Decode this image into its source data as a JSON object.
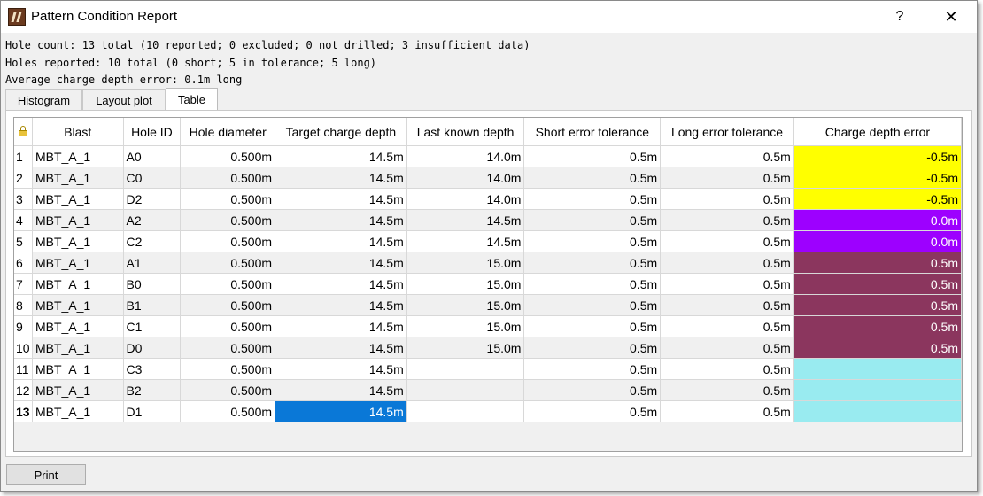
{
  "window": {
    "title": "Pattern Condition Report",
    "help_label": "?",
    "close_label": "✕"
  },
  "summary": {
    "line1": "Hole count: 13 total (10 reported; 0 excluded; 0 not drilled; 3 insufficient data)",
    "line2": "Holes reported: 10 total (0 short; 5 in tolerance; 5 long)",
    "line3": "Average charge depth error: 0.1m long"
  },
  "tabs": [
    {
      "label": "Histogram"
    },
    {
      "label": "Layout plot"
    },
    {
      "label": "Table"
    }
  ],
  "active_tab": "Table",
  "table": {
    "headers": [
      "Blast",
      "Hole ID",
      "Hole diameter",
      "Target charge depth",
      "Last known depth",
      "Short error tolerance",
      "Long error tolerance",
      "Charge depth error"
    ],
    "rows": [
      {
        "n": "1",
        "blast": "MBT_A_1",
        "hole": "A0",
        "diam": "0.500m",
        "target": "14.5m",
        "last": "14.0m",
        "short": "0.5m",
        "long": "0.5m",
        "err": "-0.5m",
        "err_color": "#ffff00",
        "err_text_color": "#000000"
      },
      {
        "n": "2",
        "blast": "MBT_A_1",
        "hole": "C0",
        "diam": "0.500m",
        "target": "14.5m",
        "last": "14.0m",
        "short": "0.5m",
        "long": "0.5m",
        "err": "-0.5m",
        "err_color": "#ffff00",
        "err_text_color": "#000000"
      },
      {
        "n": "3",
        "blast": "MBT_A_1",
        "hole": "D2",
        "diam": "0.500m",
        "target": "14.5m",
        "last": "14.0m",
        "short": "0.5m",
        "long": "0.5m",
        "err": "-0.5m",
        "err_color": "#ffff00",
        "err_text_color": "#000000"
      },
      {
        "n": "4",
        "blast": "MBT_A_1",
        "hole": "A2",
        "diam": "0.500m",
        "target": "14.5m",
        "last": "14.5m",
        "short": "0.5m",
        "long": "0.5m",
        "err": "0.0m",
        "err_color": "#9d00ff",
        "err_text_color": "#ffffff"
      },
      {
        "n": "5",
        "blast": "MBT_A_1",
        "hole": "C2",
        "diam": "0.500m",
        "target": "14.5m",
        "last": "14.5m",
        "short": "0.5m",
        "long": "0.5m",
        "err": "0.0m",
        "err_color": "#9d00ff",
        "err_text_color": "#ffffff"
      },
      {
        "n": "6",
        "blast": "MBT_A_1",
        "hole": "A1",
        "diam": "0.500m",
        "target": "14.5m",
        "last": "15.0m",
        "short": "0.5m",
        "long": "0.5m",
        "err": "0.5m",
        "err_color": "#8b365e",
        "err_text_color": "#ffffff"
      },
      {
        "n": "7",
        "blast": "MBT_A_1",
        "hole": "B0",
        "diam": "0.500m",
        "target": "14.5m",
        "last": "15.0m",
        "short": "0.5m",
        "long": "0.5m",
        "err": "0.5m",
        "err_color": "#8b365e",
        "err_text_color": "#ffffff"
      },
      {
        "n": "8",
        "blast": "MBT_A_1",
        "hole": "B1",
        "diam": "0.500m",
        "target": "14.5m",
        "last": "15.0m",
        "short": "0.5m",
        "long": "0.5m",
        "err": "0.5m",
        "err_color": "#8b365e",
        "err_text_color": "#ffffff"
      },
      {
        "n": "9",
        "blast": "MBT_A_1",
        "hole": "C1",
        "diam": "0.500m",
        "target": "14.5m",
        "last": "15.0m",
        "short": "0.5m",
        "long": "0.5m",
        "err": "0.5m",
        "err_color": "#8b365e",
        "err_text_color": "#ffffff"
      },
      {
        "n": "10",
        "blast": "MBT_A_1",
        "hole": "D0",
        "diam": "0.500m",
        "target": "14.5m",
        "last": "15.0m",
        "short": "0.5m",
        "long": "0.5m",
        "err": "0.5m",
        "err_color": "#8b365e",
        "err_text_color": "#ffffff"
      },
      {
        "n": "11",
        "blast": "MBT_A_1",
        "hole": "C3",
        "diam": "0.500m",
        "target": "14.5m",
        "last": "",
        "short": "0.5m",
        "long": "0.5m",
        "err": "",
        "err_color": "#99ebf0",
        "err_text_color": "#000000"
      },
      {
        "n": "12",
        "blast": "MBT_A_1",
        "hole": "B2",
        "diam": "0.500m",
        "target": "14.5m",
        "last": "",
        "short": "0.5m",
        "long": "0.5m",
        "err": "",
        "err_color": "#99ebf0",
        "err_text_color": "#000000"
      },
      {
        "n": "13",
        "blast": "MBT_A_1",
        "hole": "D1",
        "diam": "0.500m",
        "target": "14.5m",
        "last": "",
        "short": "0.5m",
        "long": "0.5m",
        "err": "",
        "err_color": "#99ebf0",
        "err_text_color": "#000000"
      }
    ],
    "current_row": "13",
    "selected_cell": {
      "row": "13",
      "column": "Target charge depth"
    },
    "selection_color": "#0a78d7"
  },
  "footer": {
    "print_label": "Print"
  },
  "icons": {
    "app": "app-logo-icon",
    "lock": "lock-icon"
  }
}
